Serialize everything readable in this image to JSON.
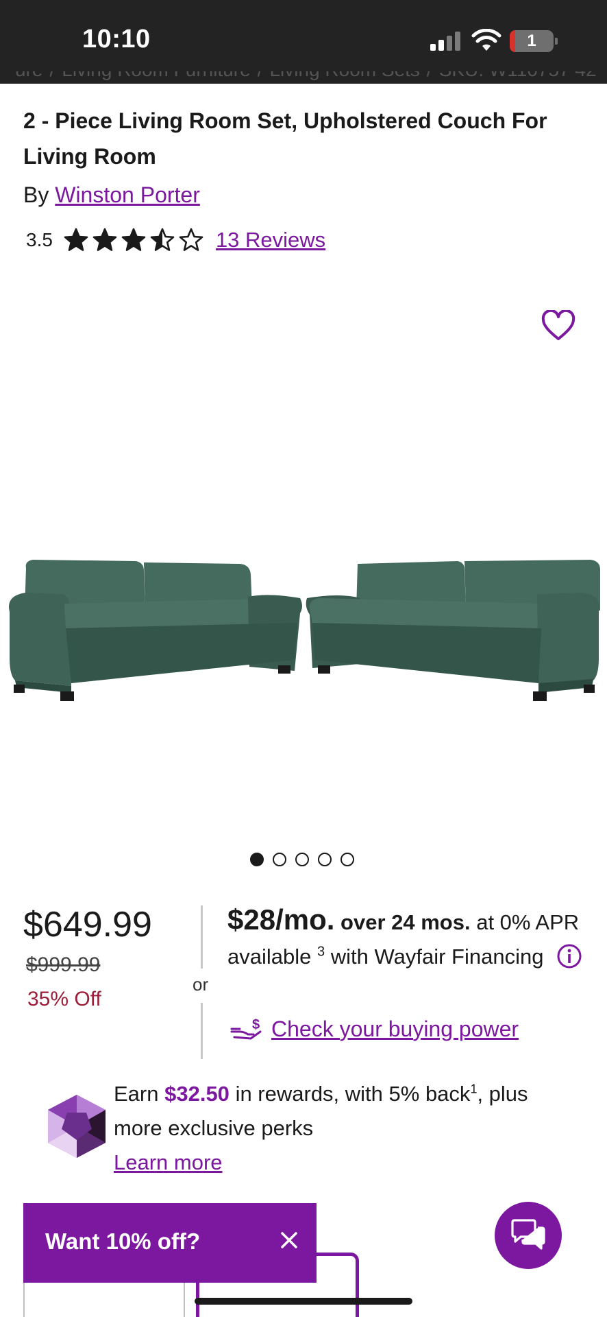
{
  "status_bar": {
    "time": "10:10",
    "battery_level": "1",
    "icons": [
      "signal-icon",
      "wifi-icon",
      "battery-icon"
    ]
  },
  "breadcrumb": {
    "items": [
      "ure",
      "Living Room Furniture",
      "Living Room Sets",
      "SKU: W110757 42"
    ],
    "separator": "/"
  },
  "product": {
    "title": "2 - Piece Living Room Set, Upholstered Couch For Living Room",
    "by_prefix": "By",
    "brand": "Winston Porter",
    "rating": "3.5",
    "rating_value": 3.5,
    "rating_max": 5,
    "reviews_label": "13 Reviews"
  },
  "gallery": {
    "image_count": 5,
    "active_index": 0,
    "sofa_color": "#3d5e52",
    "icons": [
      "heart-icon"
    ]
  },
  "pricing": {
    "price": "$649.99",
    "was_price": "$999.99",
    "discount": "35% Off",
    "or_label": "or"
  },
  "financing": {
    "monthly": "$28/mo.",
    "term": "over 24 mos.",
    "apr": "at 0% APR available",
    "footnote": "3",
    "provider": "with Wayfair Financing",
    "buying_power": "Check your buying power",
    "icons": [
      "info-icon",
      "hand-money-icon"
    ]
  },
  "rewards": {
    "earn_prefix": "Earn",
    "amount": "$32.50",
    "earn_suffix": "in rewards, with 5% back",
    "footnote": "1",
    "tail": ", plus more exclusive perks",
    "learn_more": "Learn more",
    "icons": [
      "rewards-gem-icon"
    ]
  },
  "promo": {
    "text": "Want 10% off?",
    "icons": [
      "close-icon"
    ]
  },
  "chat": {
    "icons": [
      "chat-icon"
    ]
  },
  "colors": {
    "brand_purple": "#7b189f",
    "discount_red": "#9c1d3a",
    "status_bar_bg": "#232323"
  }
}
